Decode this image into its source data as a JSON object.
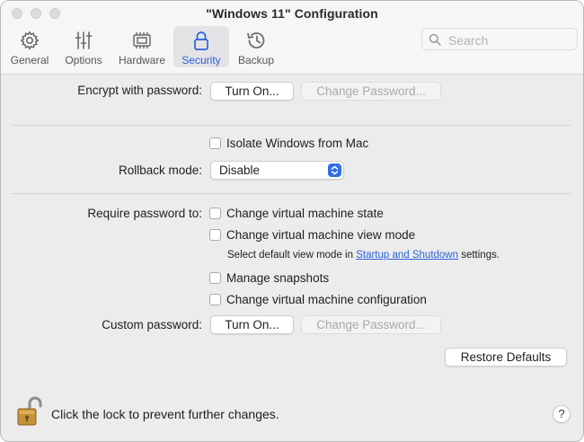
{
  "window": {
    "title": "\"Windows 11\" Configuration"
  },
  "toolbar": {
    "tabs": [
      {
        "label": "General",
        "icon": "gear-icon"
      },
      {
        "label": "Options",
        "icon": "sliders-icon"
      },
      {
        "label": "Hardware",
        "icon": "chip-icon"
      },
      {
        "label": "Security",
        "icon": "lock-icon",
        "active": true
      },
      {
        "label": "Backup",
        "icon": "history-icon"
      }
    ],
    "search_placeholder": "Search"
  },
  "encrypt": {
    "label": "Encrypt with password:",
    "turn_on": "Turn On...",
    "change_password": "Change Password..."
  },
  "isolate": {
    "label": "Isolate Windows from Mac",
    "checked": false
  },
  "rollback": {
    "label": "Rollback mode:",
    "value": "Disable"
  },
  "require": {
    "label": "Require password to:",
    "options": [
      {
        "label": "Change virtual machine state",
        "checked": false
      },
      {
        "label": "Change virtual machine view mode",
        "checked": false
      },
      {
        "label": "Manage snapshots",
        "checked": false
      },
      {
        "label": "Change virtual machine configuration",
        "checked": false
      }
    ],
    "note_prefix": "Select default view mode in ",
    "note_link": "Startup and Shutdown",
    "note_suffix": " settings."
  },
  "custom": {
    "label": "Custom password:",
    "turn_on": "Turn On...",
    "change_password": "Change Password..."
  },
  "restore_defaults": "Restore Defaults",
  "lock_message": "Click the lock to prevent further changes.",
  "help": "?",
  "colors": {
    "accent": "#2a63d9",
    "select_arrow": "#2f6fe6",
    "lock_body": "#c4923a"
  }
}
